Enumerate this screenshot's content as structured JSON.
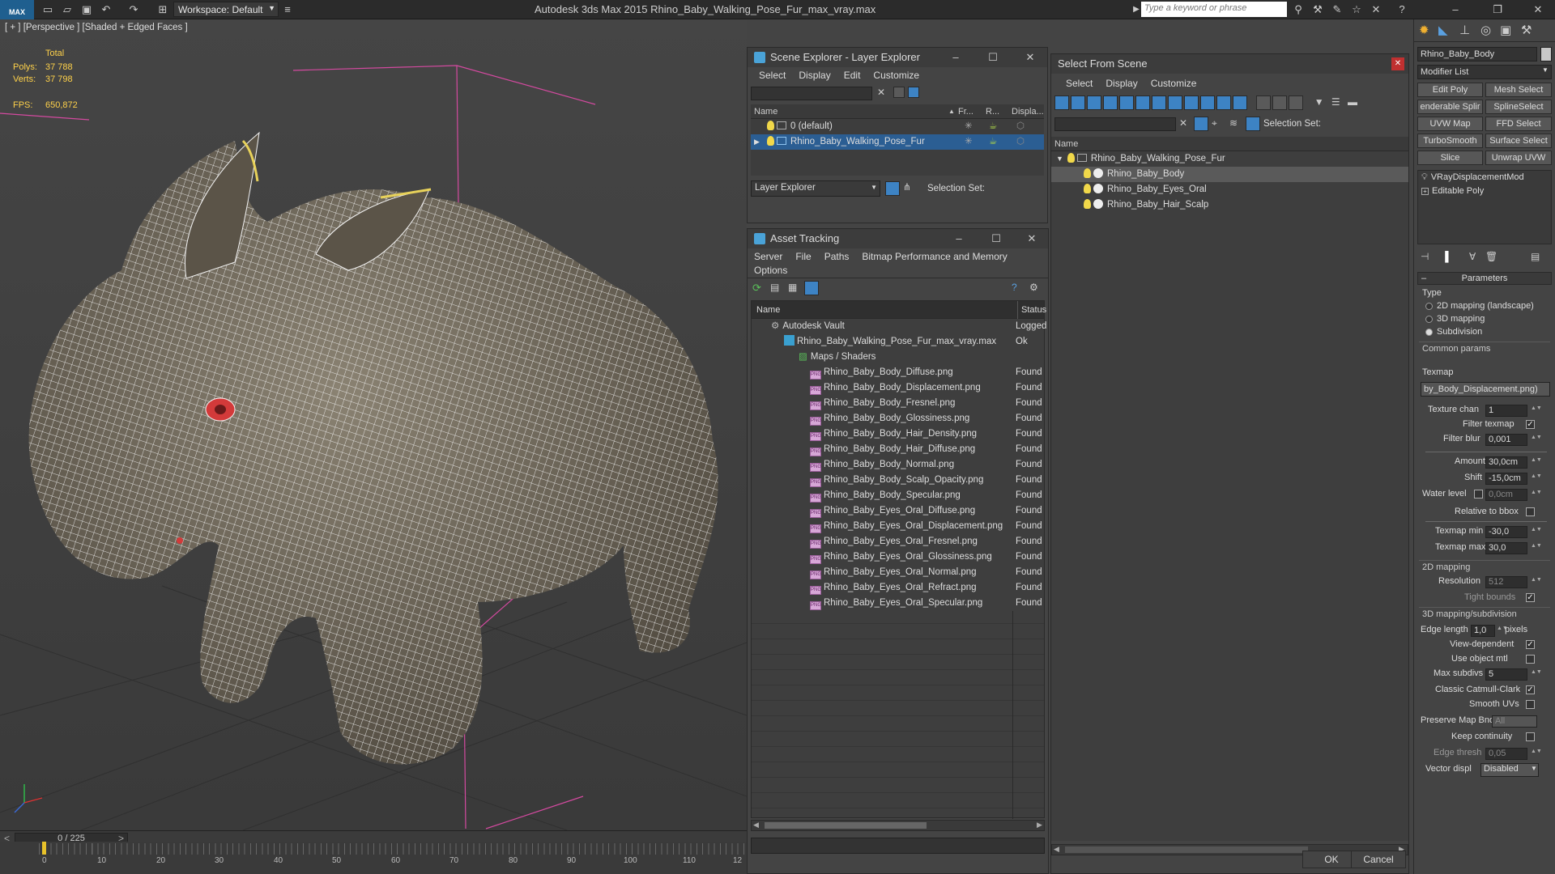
{
  "app": {
    "title": "Autodesk 3ds Max  2015     Rhino_Baby_Walking_Pose_Fur_max_vray.max",
    "logo": "MAX",
    "workspace": "Workspace: Default",
    "search_placeholder": "Type a keyword or phrase"
  },
  "viewport": {
    "label": "[ + ] [Perspective ] [Shaded + Edged Faces ]",
    "stats": {
      "total_label": "Total",
      "polys_label": "Polys:",
      "polys": "37 788",
      "verts_label": "Verts:",
      "verts": "37 798",
      "fps_label": "FPS:",
      "fps": "650,872"
    }
  },
  "timeline": {
    "frame": "0 / 225",
    "prev": "<",
    "next": ">",
    "ticks": [
      "0",
      "10",
      "20",
      "30",
      "40",
      "50",
      "60",
      "70",
      "80",
      "90",
      "100",
      "110",
      "12"
    ]
  },
  "scene_explorer": {
    "title": "Scene Explorer - Layer Explorer",
    "menu": [
      "Select",
      "Display",
      "Edit",
      "Customize"
    ],
    "columns": [
      "Name",
      "Fr...",
      "R...",
      "Displa..."
    ],
    "rows": [
      {
        "name": "0 (default)",
        "selected": false
      },
      {
        "name": "Rhino_Baby_Walking_Pose_Fur",
        "selected": true
      }
    ],
    "footer_dropdown": "Layer Explorer",
    "selection_set_label": "Selection Set:"
  },
  "asset_tracking": {
    "title": "Asset Tracking",
    "menu": [
      "Server",
      "File",
      "Paths",
      "Bitmap Performance and Memory"
    ],
    "menu2": "Options",
    "columns": [
      "Name",
      "Status"
    ],
    "vault": {
      "name": "Autodesk Vault",
      "status": "Logged"
    },
    "file": {
      "name": "Rhino_Baby_Walking_Pose_Fur_max_vray.max",
      "status": "Ok"
    },
    "group": "Maps / Shaders",
    "assets": [
      {
        "name": "Rhino_Baby_Body_Diffuse.png",
        "status": "Found"
      },
      {
        "name": "Rhino_Baby_Body_Displacement.png",
        "status": "Found"
      },
      {
        "name": "Rhino_Baby_Body_Fresnel.png",
        "status": "Found"
      },
      {
        "name": "Rhino_Baby_Body_Glossiness.png",
        "status": "Found"
      },
      {
        "name": "Rhino_Baby_Body_Hair_Density.png",
        "status": "Found"
      },
      {
        "name": "Rhino_Baby_Body_Hair_Diffuse.png",
        "status": "Found"
      },
      {
        "name": "Rhino_Baby_Body_Normal.png",
        "status": "Found"
      },
      {
        "name": "Rhino_Baby_Body_Scalp_Opacity.png",
        "status": "Found"
      },
      {
        "name": "Rhino_Baby_Body_Specular.png",
        "status": "Found"
      },
      {
        "name": "Rhino_Baby_Eyes_Oral_Diffuse.png",
        "status": "Found"
      },
      {
        "name": "Rhino_Baby_Eyes_Oral_Displacement.png",
        "status": "Found"
      },
      {
        "name": "Rhino_Baby_Eyes_Oral_Fresnel.png",
        "status": "Found"
      },
      {
        "name": "Rhino_Baby_Eyes_Oral_Glossiness.png",
        "status": "Found"
      },
      {
        "name": "Rhino_Baby_Eyes_Oral_Normal.png",
        "status": "Found"
      },
      {
        "name": "Rhino_Baby_Eyes_Oral_Refract.png",
        "status": "Found"
      },
      {
        "name": "Rhino_Baby_Eyes_Oral_Specular.png",
        "status": "Found"
      }
    ]
  },
  "select_from_scene": {
    "title": "Select From Scene",
    "menu": [
      "Select",
      "Display",
      "Customize"
    ],
    "selection_set_label": "Selection Set:",
    "column": "Name",
    "tree": [
      {
        "name": "Rhino_Baby_Walking_Pose_Fur",
        "level": 0,
        "selected": false
      },
      {
        "name": "Rhino_Baby_Body",
        "level": 1,
        "selected": true
      },
      {
        "name": "Rhino_Baby_Eyes_Oral",
        "level": 1,
        "selected": false
      },
      {
        "name": "Rhino_Baby_Hair_Scalp",
        "level": 1,
        "selected": false
      }
    ],
    "ok": "OK",
    "cancel": "Cancel"
  },
  "command_panel": {
    "object_name": "Rhino_Baby_Body",
    "modifier_list": "Modifier List",
    "buttons": [
      "Edit Poly",
      "Mesh Select",
      "enderable Splir",
      "SplineSelect",
      "UVW Map",
      "FFD Select",
      "TurboSmooth",
      "Surface Select",
      "Slice",
      "Unwrap UVW"
    ],
    "stack": [
      "VRayDisplacementMod",
      "Editable Poly"
    ],
    "rollout": "Parameters",
    "type_label": "Type",
    "types": [
      {
        "label": "2D mapping (landscape)",
        "on": false
      },
      {
        "label": "3D mapping",
        "on": false
      },
      {
        "label": "Subdivision",
        "on": true
      }
    ],
    "common_params": "Common params",
    "texmap_label": "Texmap",
    "texmap": "by_Body_Displacement.png)",
    "texture_chan_label": "Texture chan",
    "texture_chan": "1",
    "filter_texmap_label": "Filter texmap",
    "filter_blur_label": "Filter blur",
    "filter_blur": "0,001",
    "amount_label": "Amount",
    "amount": "30,0cm",
    "shift_label": "Shift",
    "shift": "-15,0cm",
    "water_level_label": "Water level",
    "water_level": "0,0cm",
    "relative_bbox_label": "Relative to bbox",
    "texmap_min_label": "Texmap min",
    "texmap_min": "-30,0",
    "texmap_max_label": "Texmap max",
    "texmap_max": "30,0",
    "mapping2d": "2D mapping",
    "resolution_label": "Resolution",
    "resolution": "512",
    "tight_bounds_label": "Tight bounds",
    "mapping3d": "3D mapping/subdivision",
    "edge_length_label": "Edge length",
    "edge_length": "1,0",
    "pixels_label": "pixels",
    "view_dependent_label": "View-dependent",
    "use_object_mtl_label": "Use object mtl",
    "max_subdivs_label": "Max subdivs",
    "max_subdivs": "5",
    "classic_catmull_label": "Classic Catmull-Clark",
    "smooth_uvs_label": "Smooth UVs",
    "preserve_map_label": "Preserve Map Bnd",
    "preserve_map": "All",
    "keep_continuity_label": "Keep continuity",
    "edge_thresh_label": "Edge thresh",
    "edge_thresh": "0,05",
    "vector_displ_label": "Vector displ",
    "vector_displ": "Disabled"
  }
}
